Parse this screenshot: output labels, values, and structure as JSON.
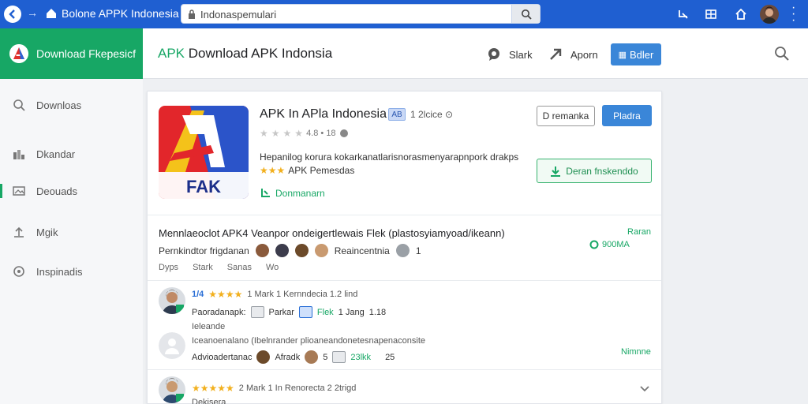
{
  "browser": {
    "window_title": "Bolone APPK Indonesia",
    "url_value": "Indonaspemulari"
  },
  "brand": {
    "label": "Download Fkepesicf"
  },
  "header": {
    "title_accent": "APK",
    "title_rest": " Download APK Indonsia",
    "link_1": "Slark",
    "link_2": "Aporn",
    "button_label": "Bdler"
  },
  "sidebar": {
    "items": [
      {
        "label": "Downloas",
        "icon": "search-icon"
      },
      {
        "label": "Dkandar",
        "icon": "bar-chart-icon"
      },
      {
        "label": "Deouads",
        "icon": "image-icon"
      },
      {
        "label": "Mgik",
        "icon": "upload-icon"
      },
      {
        "label": "Inspinadis",
        "icon": "refresh-icon"
      }
    ]
  },
  "app": {
    "icon_text": "FAK",
    "name": "APK In APla Indonesia",
    "tag": "AB",
    "meta": "1 2lcice ⊙",
    "rating_text": "4.8 • 18",
    "description": "Hepanilog korura kokarkanatlarisnorasmenyarapnpork drakps",
    "sub_description": "APK Pemesdas",
    "download_link": "Donmanarn",
    "btn_outline": "D remanka",
    "btn_blue": "Pladra",
    "btn_green": "Deran fnskenddo"
  },
  "info": {
    "title": "Mennlaeoclot APK4 Veanpor ondeigertlewais Flek (plastosyiamyoad/ikeann)",
    "subtitle": "Pernkindtor frigdanan",
    "subtitle_right": "Reaincentnia",
    "subtitle_count": "1",
    "right_1": "Raran",
    "right_2": "900MA",
    "tabs": [
      "Dyps",
      "Stark",
      "Sanas",
      "Wo"
    ]
  },
  "reviews": [
    {
      "stars_label": "1/4",
      "meta": "1 Mark  1 Kernndecia  1.2 lind",
      "line2_a": "Paoradanapk:",
      "line2_b": "Parkar",
      "line2_c": "Flek",
      "line2_d": "1 Jang",
      "line2_e": "1.18",
      "line3": "Ieleande"
    },
    {
      "line1": "Iceanoenalano  (Ibelnrander plioaneandonetesnapenaconsite",
      "line2_a": "Advioadertanac",
      "line2_b": "Afradk",
      "line2_c": "5",
      "line2_d": "23lkk",
      "line2_e": "25",
      "right": "Nimnne"
    },
    {
      "meta": "2 Mark  1 In Renorecta  2 2trigd",
      "line2": "Dekisera"
    }
  ]
}
